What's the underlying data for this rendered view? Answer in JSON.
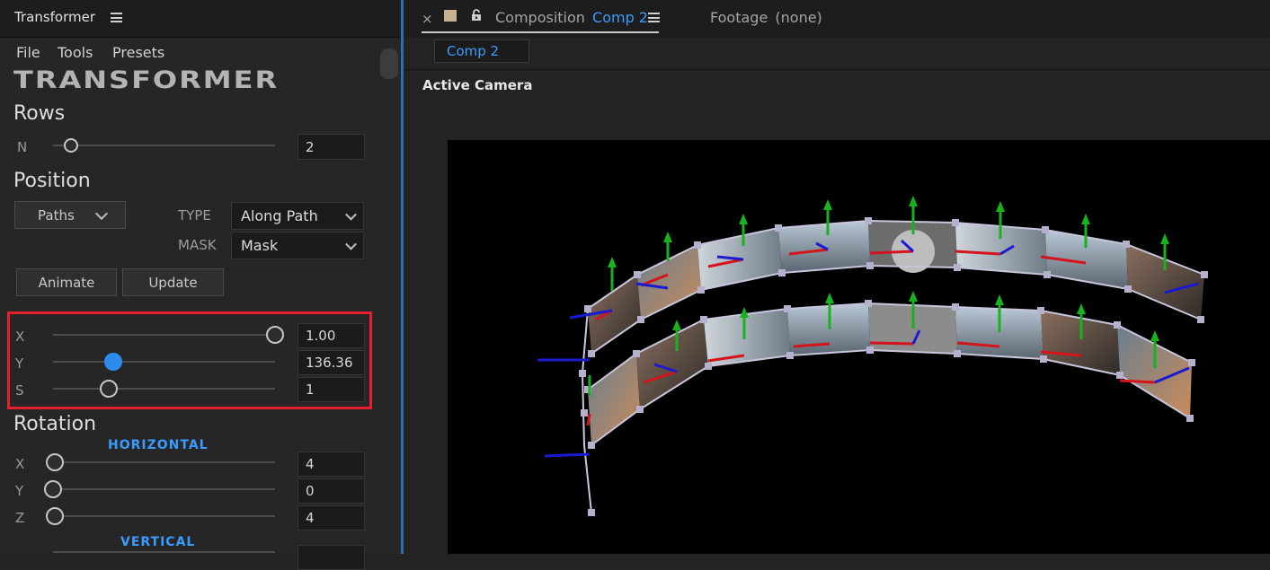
{
  "panel": {
    "title": "Transformer",
    "menu": [
      "File",
      "Tools",
      "Presets"
    ],
    "logo": "TRANSFORMER",
    "rows": {
      "heading": "Rows",
      "n_label": "N",
      "n_value": "2",
      "n_level": 0.08
    },
    "position": {
      "heading": "Position",
      "paths_button": "Paths",
      "type_label": "TYPE",
      "type_value": "Along Path",
      "mask_label": "MASK",
      "mask_value": "Mask",
      "animate_button": "Animate",
      "update_button": "Update",
      "x_label": "X",
      "x_value": "1.00",
      "x_level": 1.0,
      "y_label": "Y",
      "y_value": "136.36",
      "y_level": 0.27,
      "s_label": "S",
      "s_value": "1",
      "s_level": 0.25
    },
    "rotation": {
      "heading": "Rotation",
      "horizontal_label": "HORIZONTAL",
      "x_label": "X",
      "x_value": "4",
      "x_level": 0.01,
      "y_label": "Y",
      "y_value": "0",
      "y_level": 0.0,
      "z_label": "Z",
      "z_value": "4",
      "z_level": 0.01,
      "vertical_label": "VERTICAL"
    }
  },
  "composition": {
    "tab_prefix": "Composition",
    "tab_comp": "Comp 2",
    "footage_tab": "Footage",
    "footage_value": "(none)",
    "sub_tab": "Comp 2",
    "camera_label": "Active Camera"
  },
  "colors": {
    "accent": "#3a9bff",
    "highlight": "#e4202a",
    "axis_x": "#d4141a",
    "axis_y": "#19b21e",
    "axis_z": "#1a1ad0"
  }
}
